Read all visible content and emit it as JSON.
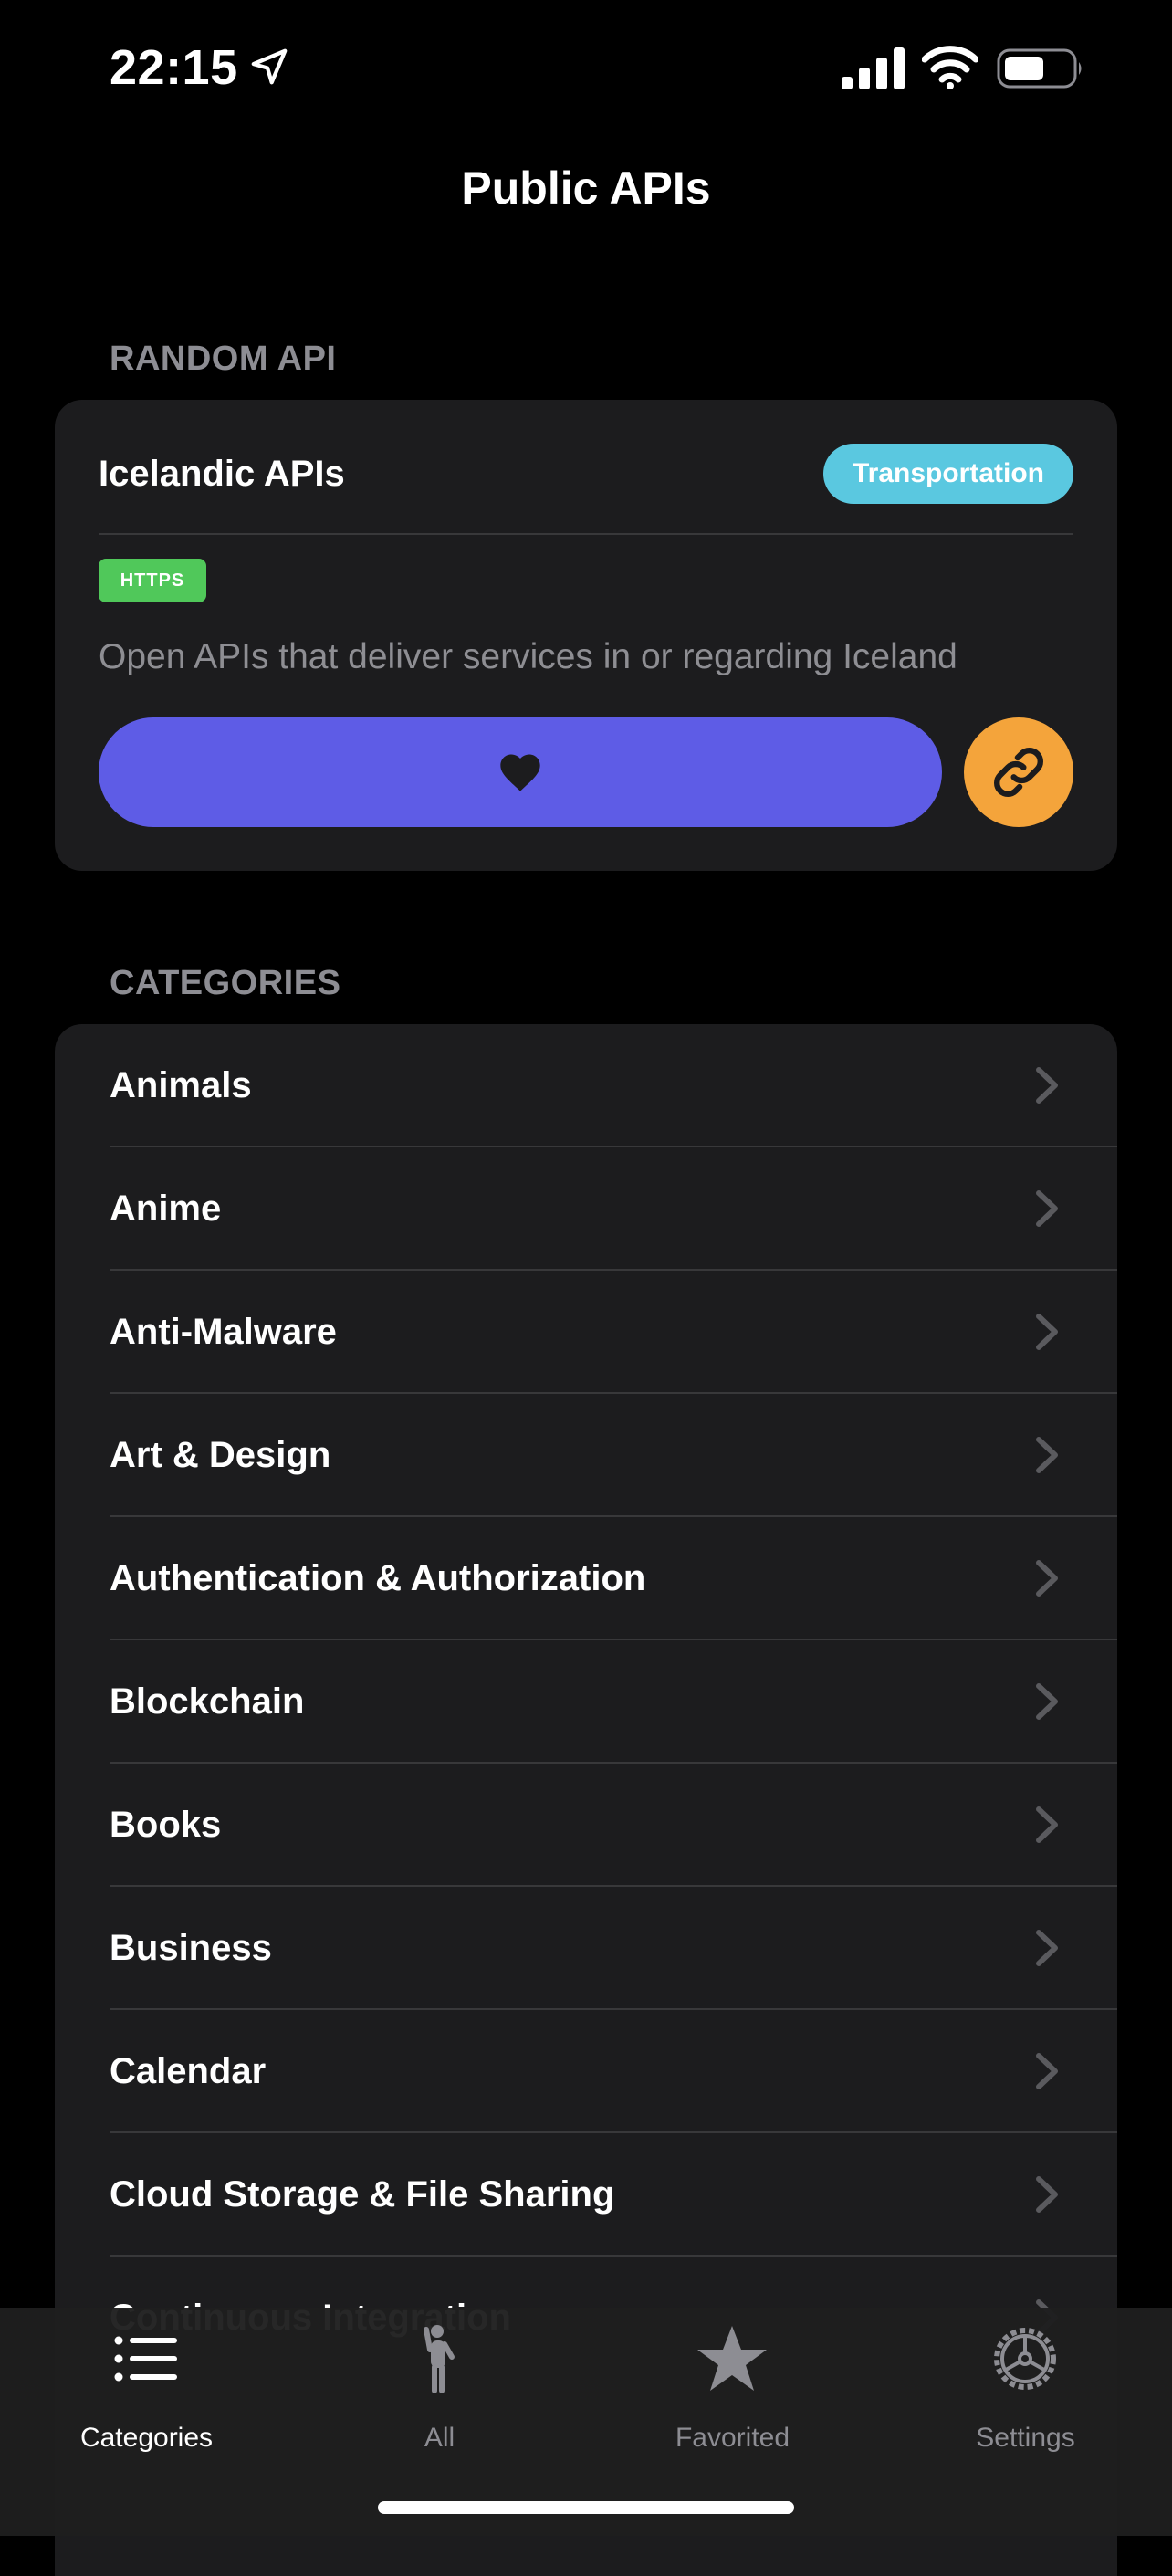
{
  "status_bar": {
    "time": "22:15",
    "icons": [
      "location-arrow-icon",
      "cellular-signal-icon",
      "wifi-icon",
      "battery-icon"
    ]
  },
  "nav": {
    "title": "Public APIs"
  },
  "random_api": {
    "section_title": "RANDOM API",
    "name": "Icelandic APIs",
    "category": "Transportation",
    "auth_badge": "HTTPS",
    "description": "Open APIs that deliver services in or regarding Iceland",
    "favorite_icon": "heart-icon",
    "link_icon": "link-icon"
  },
  "categories": {
    "section_title": "CATEGORIES",
    "items": [
      {
        "label": "Animals"
      },
      {
        "label": "Anime"
      },
      {
        "label": "Anti-Malware"
      },
      {
        "label": "Art & Design"
      },
      {
        "label": "Authentication & Authorization"
      },
      {
        "label": "Blockchain"
      },
      {
        "label": "Books"
      },
      {
        "label": "Business"
      },
      {
        "label": "Calendar"
      },
      {
        "label": "Cloud Storage & File Sharing"
      },
      {
        "label": "Continuous Integration"
      }
    ]
  },
  "tab_bar": {
    "tabs": [
      {
        "label": "Categories",
        "icon": "list-icon",
        "active": true
      },
      {
        "label": "All",
        "icon": "person-waving-icon",
        "active": false
      },
      {
        "label": "Favorited",
        "icon": "star-icon",
        "active": false
      },
      {
        "label": "Settings",
        "icon": "gear-icon",
        "active": false
      }
    ]
  },
  "colors": {
    "background": "#000000",
    "card": "#1c1c1e",
    "secondary_text": "#8d8d93",
    "category_pill": "#5ac8e0",
    "https_badge": "#50c85a",
    "favorite_button": "#5e5ce6",
    "link_button": "#f4a43b"
  }
}
